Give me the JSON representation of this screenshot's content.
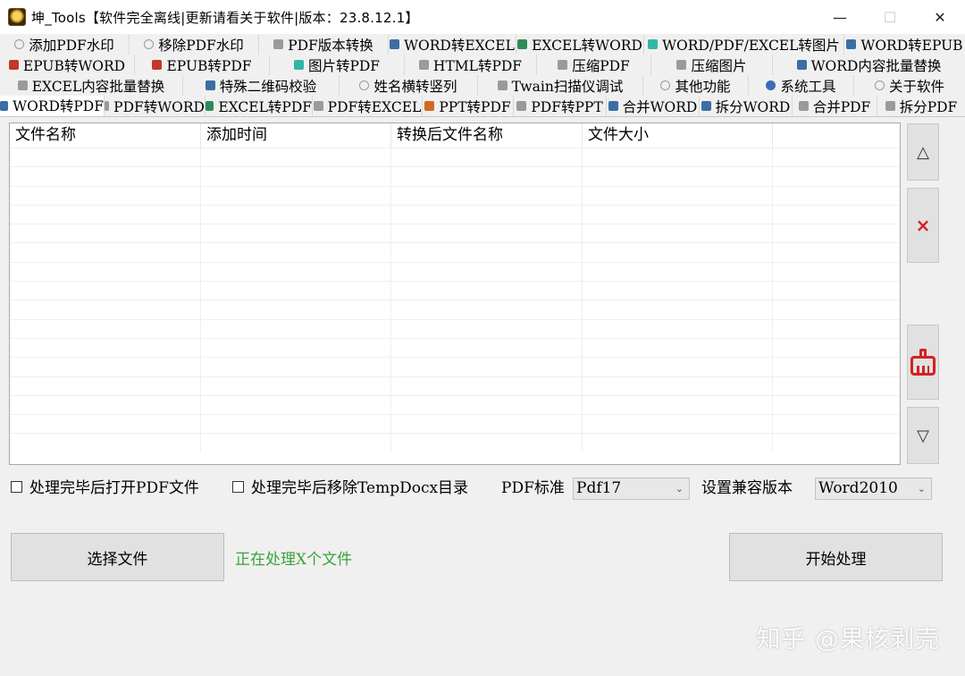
{
  "window": {
    "title": "坤_Tools【软件完全离线|更新请看关于软件|版本：23.8.12.1】",
    "controls": {
      "minimize": "—",
      "maximize": "☐",
      "close": "✕"
    }
  },
  "tabs": {
    "row1": [
      {
        "label": "添加PDF水印",
        "icon": "watermark-icon"
      },
      {
        "label": "移除PDF水印",
        "icon": "watermark-icon"
      },
      {
        "label": "PDF版本转换",
        "icon": "pdf-icon"
      },
      {
        "label": "WORD转EXCEL",
        "icon": "word-icon"
      },
      {
        "label": "EXCEL转WORD",
        "icon": "excel-icon"
      },
      {
        "label": "WORD/PDF/EXCEL转图片",
        "icon": "image-icon"
      },
      {
        "label": "WORD转EPUB",
        "icon": "word-icon"
      }
    ],
    "row2": [
      {
        "label": "EPUB转WORD",
        "icon": "epub-icon"
      },
      {
        "label": "EPUB转PDF",
        "icon": "epub-icon"
      },
      {
        "label": "图片转PDF",
        "icon": "image-icon"
      },
      {
        "label": "HTML转PDF",
        "icon": "html-icon"
      },
      {
        "label": "压缩PDF",
        "icon": "compress-icon"
      },
      {
        "label": "压缩图片",
        "icon": "compress-icon"
      },
      {
        "label": "WORD内容批量替换",
        "icon": "word-icon"
      }
    ],
    "row3": [
      {
        "label": "EXCEL内容批量替换",
        "icon": "excel-icon"
      },
      {
        "label": "特殊二维码校验",
        "icon": "qrcode-icon"
      },
      {
        "label": "姓名横转竖列",
        "icon": "name-icon"
      },
      {
        "label": "Twain扫描仪调试",
        "icon": "scanner-icon"
      },
      {
        "label": "其他功能",
        "icon": "more-icon"
      },
      {
        "label": "系统工具",
        "icon": "gear-icon"
      },
      {
        "label": "关于软件",
        "icon": "info-icon"
      }
    ],
    "row4": [
      {
        "label": "WORD转PDF",
        "icon": "word-icon",
        "active": true
      },
      {
        "label": "PDF转WORD",
        "icon": "pdf-icon"
      },
      {
        "label": "EXCEL转PDF",
        "icon": "excel-icon"
      },
      {
        "label": "PDF转EXCEL",
        "icon": "pdf-icon"
      },
      {
        "label": "PPT转PDF",
        "icon": "ppt-icon"
      },
      {
        "label": "PDF转PPT",
        "icon": "pdf-icon"
      },
      {
        "label": "合并WORD",
        "icon": "word-icon"
      },
      {
        "label": "拆分WORD",
        "icon": "word-icon"
      },
      {
        "label": "合并PDF",
        "icon": "pdf-icon"
      },
      {
        "label": "拆分PDF",
        "icon": "pdf-icon"
      }
    ]
  },
  "file_list": {
    "columns": [
      "文件名称",
      "添加时间",
      "转换后文件名称",
      "文件大小",
      ""
    ],
    "rows": []
  },
  "side_buttons": {
    "up": "△",
    "delete": "×",
    "down": "▽"
  },
  "options": {
    "open_pdf_label": "处理完毕后打开PDF文件",
    "remove_temp_label": "处理完毕后移除TempDocx目录",
    "pdf_standard_label": "PDF标准",
    "pdf_standard_value": "Pdf17",
    "compat_label": "设置兼容版本",
    "compat_value": "Word2010",
    "open_pdf_checked": false,
    "remove_temp_checked": false
  },
  "actions": {
    "choose_files": "选择文件",
    "status": "正在处理X个文件",
    "start": "开始处理"
  },
  "watermark": "知乎 @果核剥壳",
  "colors": {
    "status_green": "#3aa23a",
    "delete_red": "#d62020",
    "accent_blue": "#3a6ea5"
  }
}
